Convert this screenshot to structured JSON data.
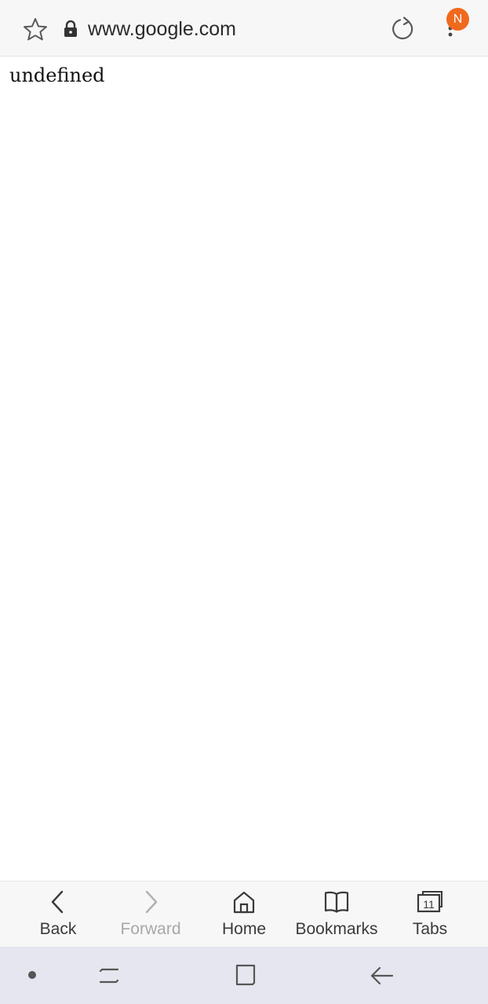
{
  "browser": {
    "url": "www.google.com",
    "badge_letter": "N",
    "accent_color": "#f06a1e"
  },
  "page": {
    "body_text": "undefined"
  },
  "toolbar": {
    "back_label": "Back",
    "forward_label": "Forward",
    "home_label": "Home",
    "bookmarks_label": "Bookmarks",
    "tabs_label": "Tabs",
    "tab_count": "11"
  },
  "icons": {
    "star": "star-icon",
    "lock": "lock-icon",
    "reload": "reload-icon",
    "menu": "more-vertical-icon",
    "back": "chevron-left-icon",
    "forward": "chevron-right-icon",
    "home": "home-icon",
    "bookmarks": "book-icon",
    "tabs": "tabs-icon"
  }
}
